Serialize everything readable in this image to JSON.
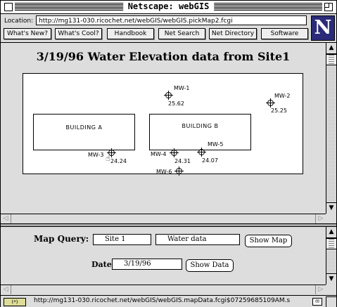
{
  "window": {
    "title": "Netscape: webGIS"
  },
  "location": {
    "label": "Location:",
    "url": "http://mg131-030.ricochet.net/webGIS/webGIS.pickMap2.fcgi"
  },
  "directory_buttons": [
    "What's New?",
    "What's Cool?",
    "Handbook",
    "Net Search",
    "Net Directory",
    "Software"
  ],
  "logo": {
    "letter": "N",
    "color": "#2b2b7a"
  },
  "page": {
    "title": "3/19/96 Water Elevation data from Site1"
  },
  "map": {
    "buildings": [
      {
        "label": "BUILDING A"
      },
      {
        "label": "BUILDING B"
      }
    ],
    "wells": [
      {
        "name": "MW-1",
        "value": "25.62"
      },
      {
        "name": "MW-2",
        "value": "25.25"
      },
      {
        "name": "MW-3",
        "value": "24.24"
      },
      {
        "name": "MW-4",
        "value": "24.31"
      },
      {
        "name": "MW-5",
        "value": "24.07"
      },
      {
        "name": "MW-6",
        "value": ""
      }
    ]
  },
  "query": {
    "map_query_label": "Map Query:",
    "site_value": "Site 1",
    "data_value": "Water data",
    "show_map_label": "Show Map",
    "date_label": "Date:",
    "date_value": "3/19/96",
    "show_data_label": "Show Data"
  },
  "status": {
    "key_label": "(*)",
    "text": "http://mg131-030.ricochet.net/webGIS/webGIS.mapData.fcgi$07259685109AM.s"
  },
  "icons": {
    "close": "close-box-icon",
    "zoom": "zoom-box-icon",
    "scroll_up": "arrow-up-icon",
    "scroll_down": "arrow-down-icon",
    "scroll_left": "arrow-left-icon",
    "scroll_right": "arrow-right-icon",
    "mail": "mail-icon",
    "security": "security-key-icon",
    "well": "crosshair-well-icon"
  }
}
